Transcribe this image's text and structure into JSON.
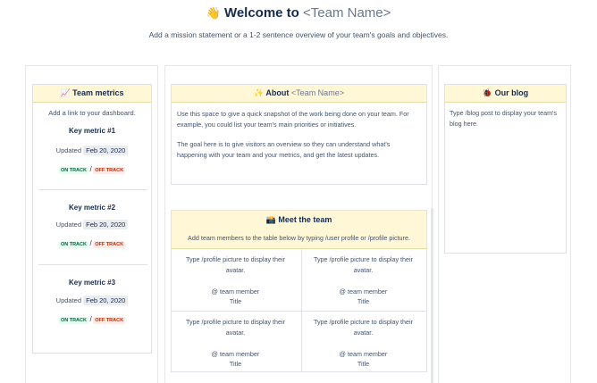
{
  "hero": {
    "emoji": "👋",
    "title": "Welcome to ",
    "placeholder": "<Team Name>",
    "subtitle": "Add a mission statement or a 1-2 sentence overview of your team's goals and objectives."
  },
  "metrics": {
    "emoji": "📈",
    "title": "Team metrics",
    "note": "Add a link to your dashboard.",
    "items": [
      {
        "name": "Key metric #1",
        "updated": "Updated",
        "date": "Feb 20, 2020",
        "on": "ON TRACK",
        "sep": "/",
        "off": "OFF TRACK"
      },
      {
        "name": "Key metric #2",
        "updated": "Updated",
        "date": "Feb 20, 2020",
        "on": "ON TRACK",
        "sep": "/",
        "off": "OFF TRACK"
      },
      {
        "name": "Key metric #3",
        "updated": "Updated",
        "date": "Feb 20, 2020",
        "on": "ON TRACK",
        "sep": "/",
        "off": "OFF TRACK"
      }
    ]
  },
  "about": {
    "emoji": "✨",
    "title": "About ",
    "placeholder": "<Team Name>",
    "p1": "Use this space to give a quick snapshot of the work being done on your team. For example, you could list your team's main priorities or initiatives.",
    "p2": "The goal here is to give visitors an overview so they can understand what's happening with your team and your metrics, and get the latest updates."
  },
  "blog": {
    "emoji": "🐞",
    "title": "Our blog",
    "text": "Type /blog post to display your team's blog here."
  },
  "team": {
    "emoji": "📸",
    "title": "Meet the team",
    "instructions": "Add team members to the table below by typing /user profile or /profile picture.",
    "members": [
      {
        "picture": "Type /profile picture to display their avatar.",
        "member": "@ team member",
        "role": "Title"
      },
      {
        "picture": "Type /profile picture to display their avatar.",
        "member": "@ team member",
        "role": "Title"
      },
      {
        "picture": "Type /profile picture to display their avatar.",
        "member": "@ team member",
        "role": "Title"
      },
      {
        "picture": "Type /profile picture to display their avatar.",
        "member": "@ team member",
        "role": "Title"
      }
    ]
  }
}
